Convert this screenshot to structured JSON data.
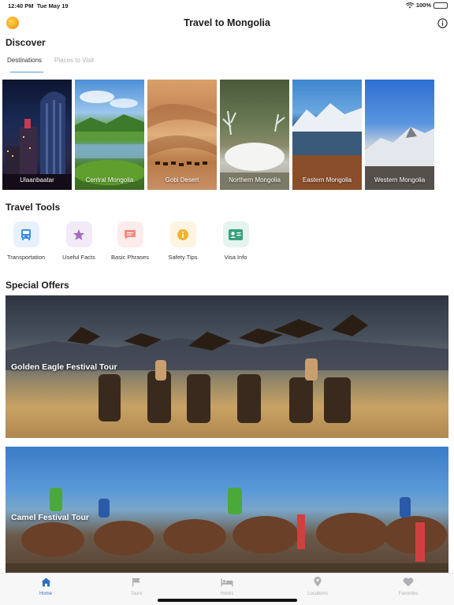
{
  "status": {
    "time": "12:40 PM",
    "date": "Tue May 19",
    "battery": "100%"
  },
  "nav": {
    "title": "Travel to Mongolia",
    "logo_icon": "mongolian-symbol-icon",
    "info_icon": "info-icon"
  },
  "discover": {
    "title": "Discover",
    "tabs": [
      {
        "label": "Destinations",
        "active": true
      },
      {
        "label": "Places to Visit",
        "active": false
      }
    ],
    "destinations": [
      {
        "name": "Ulaanbaatar"
      },
      {
        "name": "Central Mongolia"
      },
      {
        "name": "Gobi Desert"
      },
      {
        "name": "Northern Mongolia"
      },
      {
        "name": "Eastern Mongolia"
      },
      {
        "name": "Western Mongolia"
      }
    ]
  },
  "tools": {
    "title": "Travel Tools",
    "items": [
      {
        "label": "Transportation",
        "icon": "bus-icon",
        "color": "#3a8ee6",
        "bg": "#e6f1fb"
      },
      {
        "label": "Useful Facts",
        "icon": "star-icon",
        "color": "#a569bd",
        "bg": "#f2eaf7"
      },
      {
        "label": "Basic Phrases",
        "icon": "chat-bubble-icon",
        "color": "#f28b82",
        "bg": "#fdecec"
      },
      {
        "label": "Safety Tips",
        "icon": "info-circle-icon",
        "color": "#f0b232",
        "bg": "#fdf4e1"
      },
      {
        "label": "Visa Info",
        "icon": "id-card-icon",
        "color": "#3aa17e",
        "bg": "#e4f4ef"
      }
    ]
  },
  "offers": {
    "title": "Special Offers",
    "items": [
      {
        "label": "Golden Eagle Festival Tour"
      },
      {
        "label": "Camel Festival Tour"
      }
    ]
  },
  "tabbar": {
    "items": [
      {
        "label": "Home",
        "icon": "home-icon",
        "active": true
      },
      {
        "label": "Tours",
        "icon": "flag-icon",
        "active": false
      },
      {
        "label": "Hotels",
        "icon": "bed-icon",
        "active": false
      },
      {
        "label": "Locations",
        "icon": "map-pin-icon",
        "active": false
      },
      {
        "label": "Favorites",
        "icon": "heart-icon",
        "active": false
      }
    ]
  },
  "colors": {
    "accent": "#2f6fc0",
    "tab_underline": "#5a9bd5",
    "inactive": "#b0b0b4"
  }
}
